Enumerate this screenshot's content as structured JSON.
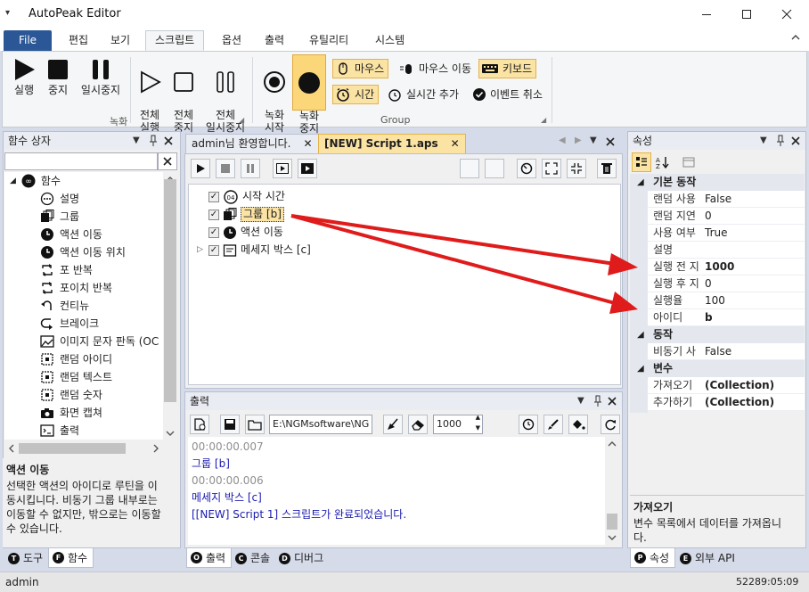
{
  "window": {
    "title": "AutoPeak Editor",
    "menu_icon": "▾"
  },
  "ribbon_tabs": [
    "File",
    "편집",
    "보기",
    "스크립트",
    "옵션",
    "출력",
    "유틸리티",
    "시스템"
  ],
  "ribbon": {
    "record_group": {
      "label": "녹화",
      "buttons": [
        {
          "name": "play",
          "label": "실행"
        },
        {
          "name": "stop",
          "label": "중지"
        },
        {
          "name": "pause",
          "label": "일시중지"
        },
        {
          "name": "run-all",
          "label": "전체\n실행"
        },
        {
          "name": "stop-all",
          "label": "전체\n중지"
        },
        {
          "name": "pause-all",
          "label": "전체\n일시중지"
        }
      ]
    },
    "group_group": {
      "label": "Group",
      "buttons": [
        {
          "name": "record-start",
          "label": "녹화\n시작"
        },
        {
          "name": "record-stop",
          "label": "녹화\n중지"
        }
      ],
      "small_buttons": [
        {
          "name": "mouse",
          "label": "마우스",
          "highlight": true
        },
        {
          "name": "mouse-move",
          "label": "마우스 이동",
          "highlight": false
        },
        {
          "name": "keyboard",
          "label": "키보드",
          "highlight": true
        },
        {
          "name": "time",
          "label": "시간",
          "highlight": true
        },
        {
          "name": "realtime-add",
          "label": "실시간 추가",
          "highlight": false
        },
        {
          "name": "event-cancel",
          "label": "이벤트 취소",
          "highlight": false
        }
      ]
    }
  },
  "left_panel": {
    "title": "함수 상자",
    "root": "함수",
    "items": [
      {
        "icon": "info-circle",
        "label": "설명"
      },
      {
        "icon": "group",
        "label": "그룹"
      },
      {
        "icon": "action-move",
        "label": "액션 이동"
      },
      {
        "icon": "action-move",
        "label": "액션 이동 위치"
      },
      {
        "icon": "loop",
        "label": "포 반복"
      },
      {
        "icon": "loop",
        "label": "포이치 반복"
      },
      {
        "icon": "continue",
        "label": "컨티뉴"
      },
      {
        "icon": "break",
        "label": "브레이크"
      },
      {
        "icon": "image-text",
        "label": "이미지 문자 판독 (OC"
      },
      {
        "icon": "random",
        "label": "랜덤 아이디"
      },
      {
        "icon": "random",
        "label": "랜덤 텍스트"
      },
      {
        "icon": "random",
        "label": "랜덤 숫자"
      },
      {
        "icon": "camera",
        "label": "화면 캡쳐"
      },
      {
        "icon": "output",
        "label": "출력"
      }
    ],
    "desc_title": "액션 이동",
    "desc_text": [
      "선택한 액션의 아이디로 루틴을 이",
      "동시킵니다. 비동기 그룹 내부로는",
      "이동할 수 없지만, 밖으로는 이동할",
      "수 있습니다."
    ],
    "tabs": [
      {
        "key": "T",
        "label": "도구"
      },
      {
        "key": "F",
        "label": "함수"
      }
    ]
  },
  "doc_tabs": [
    {
      "label": "admin님 환영합니다.",
      "active": false
    },
    {
      "label": "[NEW] Script 1.aps",
      "active": true
    }
  ],
  "script_tree": [
    {
      "label": "시작 시간",
      "icon": "clock-04",
      "selected": false,
      "expander": false
    },
    {
      "label": "그룹 [b]",
      "icon": "group",
      "selected": true,
      "expander": false
    },
    {
      "label": "액션 이동",
      "icon": "action-move",
      "selected": false,
      "expander": false
    },
    {
      "label": "메세지 박스 [c]",
      "icon": "message",
      "selected": false,
      "expander": true
    }
  ],
  "output_panel": {
    "title": "출력",
    "path": "E:\\NGMsoftware\\NG",
    "count": "1000",
    "lines": [
      {
        "text": "00:00:00.007",
        "style": "ts"
      },
      {
        "text": "그룹 [b]",
        "style": "bl"
      },
      {
        "text": "00:00:00.006",
        "style": "ts"
      },
      {
        "text": "메세지 박스 [c]",
        "style": "bl"
      },
      {
        "text": "[[NEW] Script 1] 스크립트가 완료되었습니다.",
        "style": "bl"
      }
    ],
    "tabs": [
      {
        "key": "O",
        "label": "출력"
      },
      {
        "key": "C",
        "label": "콘솔"
      },
      {
        "key": "D",
        "label": "디버그"
      }
    ]
  },
  "properties": {
    "title": "속성",
    "categories": [
      {
        "name": "기본 동작",
        "rows": [
          {
            "key": "랜덤 사용",
            "value": "False",
            "bold": false
          },
          {
            "key": "랜덤 지연",
            "value": "0",
            "bold": false
          },
          {
            "key": "사용 여부",
            "value": "True",
            "bold": false
          },
          {
            "key": "설명",
            "value": "",
            "bold": false
          },
          {
            "key": "실행 전 지",
            "value": "1000",
            "bold": true
          },
          {
            "key": "실행 후 지",
            "value": "0",
            "bold": false
          },
          {
            "key": "실행율",
            "value": "100",
            "bold": false
          },
          {
            "key": "아이디",
            "value": "b",
            "bold": true
          }
        ]
      },
      {
        "name": "동작",
        "rows": [
          {
            "key": "비동기 사",
            "value": "False",
            "bold": false
          }
        ]
      },
      {
        "name": "변수",
        "rows": [
          {
            "key": "가져오기",
            "value": "(Collection)",
            "bold": true
          },
          {
            "key": "추가하기",
            "value": "(Collection)",
            "bold": true
          }
        ]
      }
    ],
    "desc_title": "가져오기",
    "desc_text": [
      "변수 목록에서 데이터를 가져옵니",
      "다."
    ],
    "tabs": [
      {
        "key": "P",
        "label": "속성"
      },
      {
        "key": "E",
        "label": "외부 API"
      }
    ]
  },
  "status": {
    "user": "admin",
    "time": "52289:05:09"
  },
  "colors": {
    "file_tab": "#2b5797",
    "highlight": "#fbe3a4",
    "arrow": "#e01b1b",
    "output_blue": "#1b1bb0"
  }
}
